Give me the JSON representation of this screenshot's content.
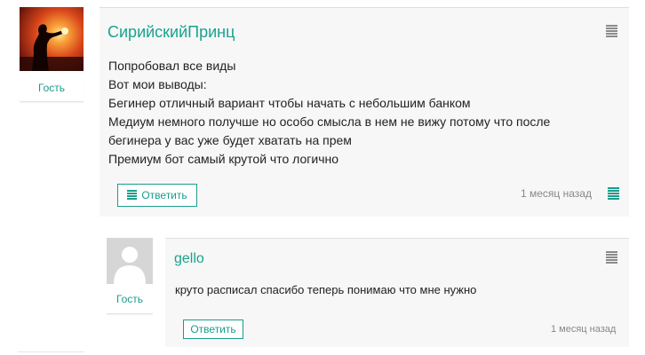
{
  "comments": [
    {
      "author": "СирийскийПринц",
      "role": "Гость",
      "lines": [
        "Попробовал все виды",
        "Вот мои выводы:",
        "Бегинер отличный вариант чтобы начать с небольшим банком",
        "Медиум немного получше но особо смысла в нем не вижу потому что после",
        "бегинера у вас уже будет хватать на прем",
        "Премиум бот самый крутой что логично"
      ],
      "reply_label": "Ответить",
      "timestamp": "1 месяц назад",
      "avatar": "sunset-silhouette-photo",
      "menu_icon": "hamburger-menu-icon"
    },
    {
      "author": "gello",
      "role": "Гость",
      "lines": [
        "круто расписал спасибо теперь понимаю что мне нужно"
      ],
      "reply_label": "Ответить",
      "timestamp": "1 месяц назад",
      "avatar": "default-user-avatar",
      "menu_icon": "hamburger-menu-icon"
    }
  ],
  "colors": {
    "accent": "#1a9c8a",
    "box_bg": "#f7f7f7",
    "timestamp": "#888888",
    "icon_gray": "#8b8b8b"
  }
}
